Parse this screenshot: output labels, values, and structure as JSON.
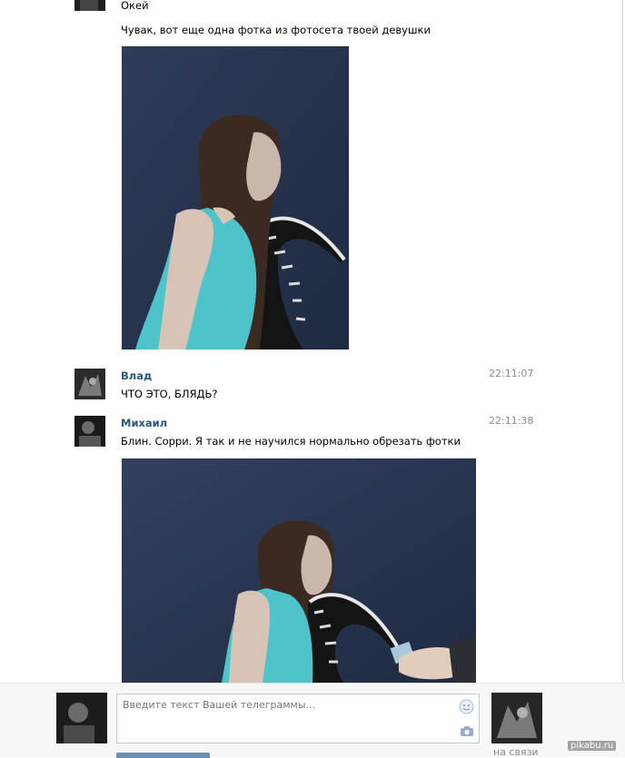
{
  "messages": [
    {
      "text": "Окей"
    },
    {
      "text": "Чувак, вот еще одна фотка из фотосета твоей девушки"
    },
    {
      "author": "Влад",
      "time": "22:11:07",
      "text": "ЧТО ЭТО, БЛЯДЬ?"
    },
    {
      "author": "Михаил",
      "time": "22:11:38",
      "text": "Блин. Сорри. Я так и не научился нормально обрезать фотки"
    }
  ],
  "composer": {
    "placeholder": "Введите текст Вашей телеграммы...",
    "status": "на связи"
  },
  "watermark": "pikabu.ru",
  "colors": {
    "author_link": "#2b587a",
    "photo_background": "#29354e",
    "top_color": "#4ec3c9",
    "button": "#6d8fb3"
  },
  "icons": [
    "smile-icon",
    "camera-icon"
  ]
}
